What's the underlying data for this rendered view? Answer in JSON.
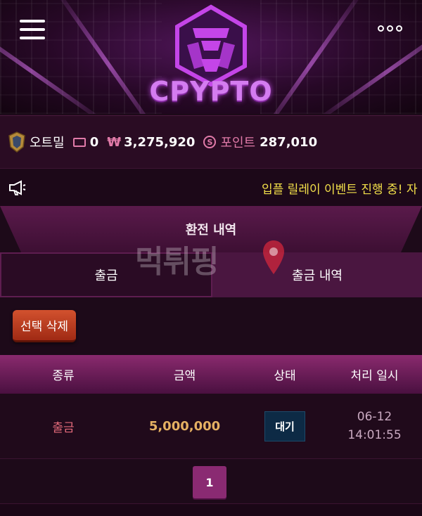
{
  "header": {
    "brand": "CPYPTO",
    "menu_icon": "hamburger-menu-icon",
    "more_icon": "more-dots-icon"
  },
  "user": {
    "nickname": "오트밀",
    "messages": "0",
    "currency_symbol": "₩",
    "balance": "3,275,920",
    "points_label": "포인트",
    "points": "287,010"
  },
  "notice": {
    "text": "입플 릴레이 이벤트 진행 중! 자"
  },
  "section": {
    "title": "환전 내역"
  },
  "tabs": [
    {
      "label": "출금"
    },
    {
      "label": "출금 내역"
    }
  ],
  "actions": {
    "delete_selected": "선택 삭제"
  },
  "table": {
    "headers": [
      "종류",
      "금액",
      "상태",
      "처리 일시"
    ],
    "rows": [
      {
        "type": "출금",
        "amount": "5,000,000",
        "status": "대기",
        "date": "06-12",
        "time": "14:01:55"
      }
    ]
  },
  "pagination": {
    "current": "1"
  },
  "watermark": {
    "text": "먹튀핑"
  },
  "colors": {
    "accent": "#8a2a72",
    "notice": "#f3e04a",
    "amount": "#e5b062",
    "type": "#e26a7a"
  }
}
